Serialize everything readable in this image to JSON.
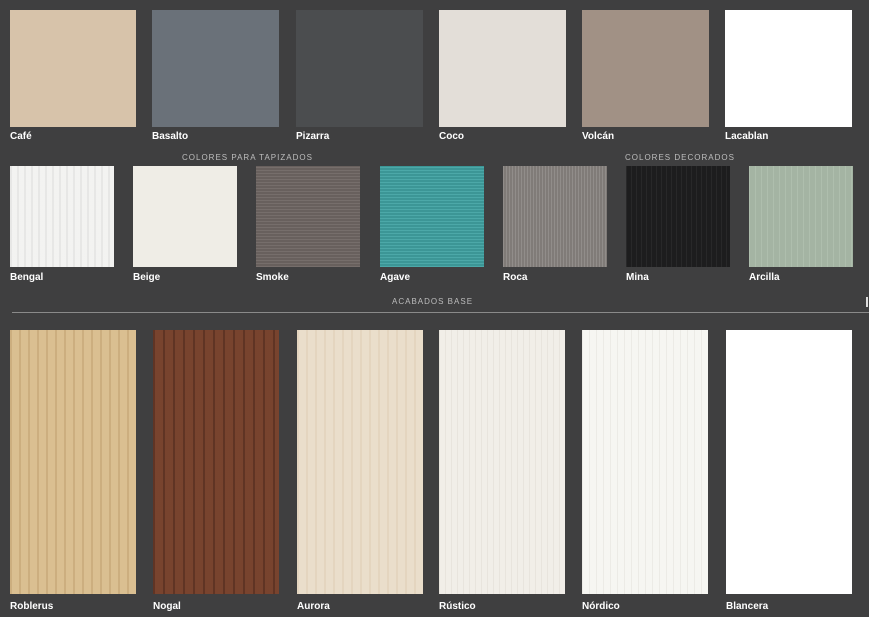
{
  "sections": {
    "upholstery_title": "COLORES PARA TAPIZADOS",
    "decor_title": "COLORES DECORADOS",
    "base_title": "ACABADOS BASE"
  },
  "row1": [
    {
      "name": "Café",
      "color": "#d7c3aa"
    },
    {
      "name": "Basalto",
      "color": "#6a7179"
    },
    {
      "name": "Pizarra",
      "color": "#4b4d4f"
    },
    {
      "name": "Coco",
      "color": "#e3ded8"
    },
    {
      "name": "Volcán",
      "color": "#a19185"
    },
    {
      "name": "Lacablan",
      "color": "#ffffff"
    }
  ],
  "row2": [
    {
      "name": "Bengal",
      "color": "#f1f1ef"
    },
    {
      "name": "Beige",
      "color": "#efede6"
    },
    {
      "name": "Smoke",
      "color": "#6f6663"
    },
    {
      "name": "Agave",
      "color": "#41a3a3"
    },
    {
      "name": "Roca",
      "color": "#888380"
    },
    {
      "name": "Mina",
      "color": "#1f1f20"
    },
    {
      "name": "Arcilla",
      "color": "#a9baa8"
    }
  ],
  "row3": [
    {
      "name": "Roblerus",
      "color": "#d7bb8d"
    },
    {
      "name": "Nogal",
      "color": "#6f3e2c"
    },
    {
      "name": "Aurora",
      "color": "#e9dcc8"
    },
    {
      "name": "Rústico",
      "color": "#f0ede7"
    },
    {
      "name": "Nórdico",
      "color": "#f6f5f1"
    },
    {
      "name": "Blancera",
      "color": "#ffffff"
    }
  ]
}
